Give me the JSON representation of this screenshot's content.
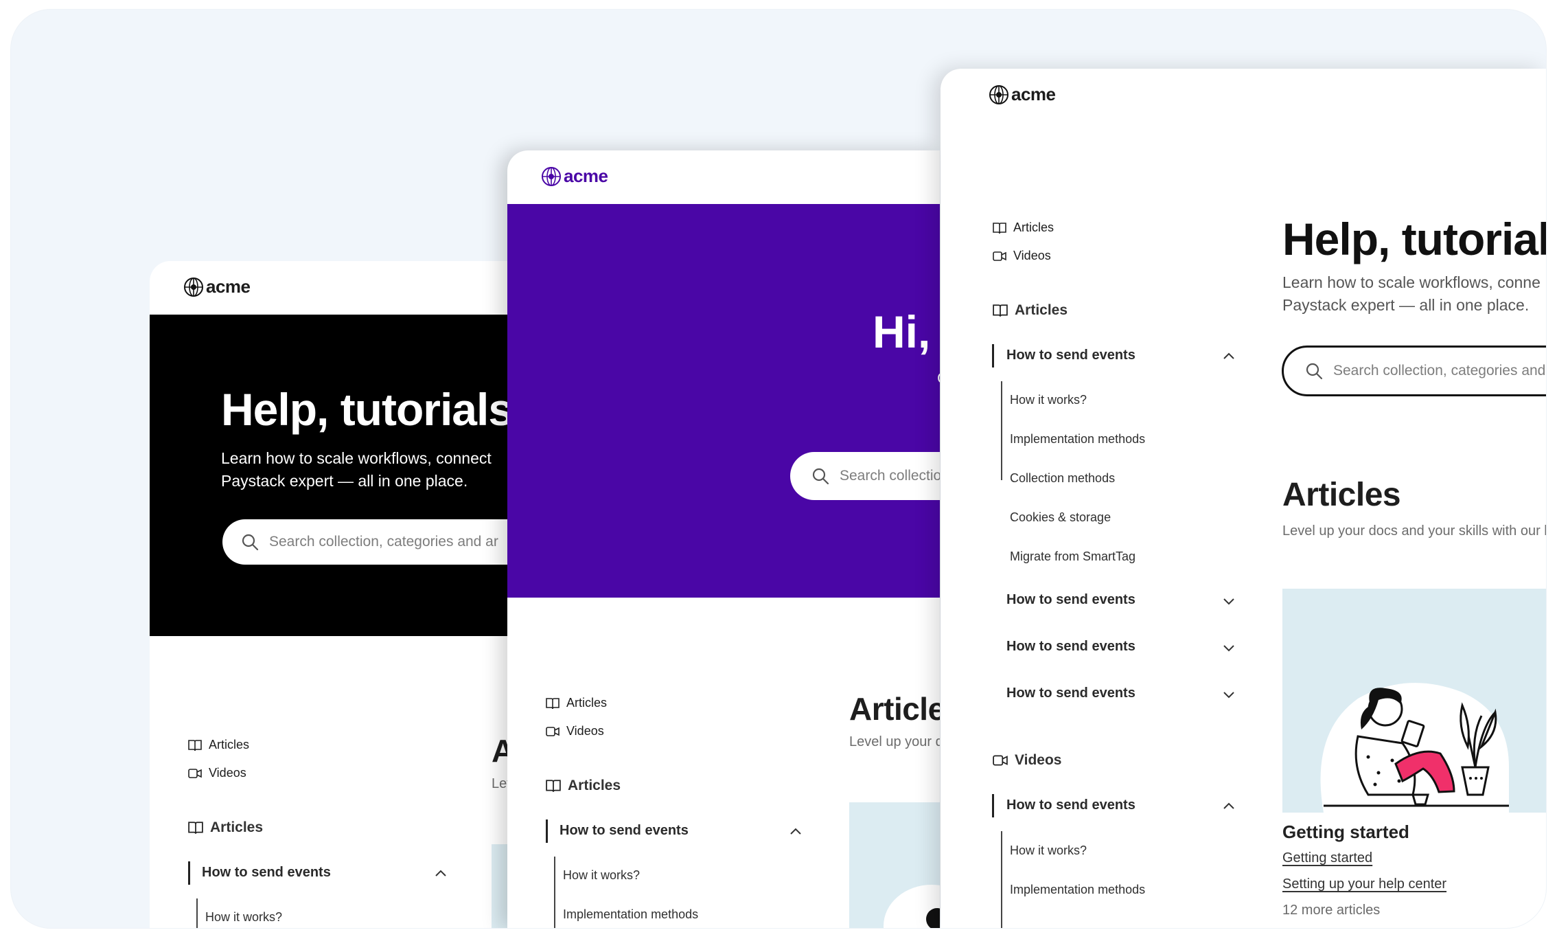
{
  "brand": {
    "name": "acme"
  },
  "panel_dark": {
    "hero_bg": "#000000",
    "title": "Help, tutorials",
    "subtitle_line1": "Learn how to scale workflows, connect",
    "subtitle_line2": "Paystack expert — all in one place.",
    "search_placeholder": "Search collection, categories and ar",
    "nav": {
      "articles": "Articles",
      "videos": "Videos"
    },
    "section_articles": "Articles",
    "group1": "How to send events",
    "sub1": "How it works?",
    "heading_partial": "Ar",
    "level_partial": "Leve"
  },
  "panel_purple": {
    "hero_bg": "#4a06a6",
    "brand_color": "#4a06a6",
    "title_partial": "Hi, I",
    "subtitle_partial": "Ge",
    "search_placeholder": "Search collectio",
    "nav": {
      "articles": "Articles",
      "videos": "Videos"
    },
    "section_articles": "Articles",
    "group1": "How to send events",
    "sub1": "How it works?",
    "sub2": "Implementation methods",
    "heading_partial": "Articles",
    "level_partial": "Level up your doc"
  },
  "panel_light": {
    "nav": {
      "articles": "Articles",
      "videos": "Videos"
    },
    "section_articles": "Articles",
    "group_open": "How to send events",
    "group_open_items": [
      "How it works?",
      "Implementation methods",
      "Collection methods",
      "Cookies & storage",
      "Migrate from SmartTag"
    ],
    "group_closed": [
      "How to send events",
      "How to send events",
      "How to send events"
    ],
    "section_videos": "Videos",
    "video_group": "How to send events",
    "video_items": [
      "How it works?",
      "Implementation methods"
    ],
    "title": "Help, tutorial",
    "subtitle_line1": "Learn how to scale workflows, conne",
    "subtitle_line2": "Paystack expert — all in one place.",
    "search_placeholder": "Search collection, categories and",
    "articles_heading": "Articles",
    "articles_sub": "Level up your docs and your skills with our li",
    "card_title": "Getting started",
    "card_links": [
      "Getting started",
      "Setting up your  help center"
    ],
    "card_more": "12 more articles",
    "card_bg": "#dcecf2",
    "accent_pink": "#f0306a"
  }
}
